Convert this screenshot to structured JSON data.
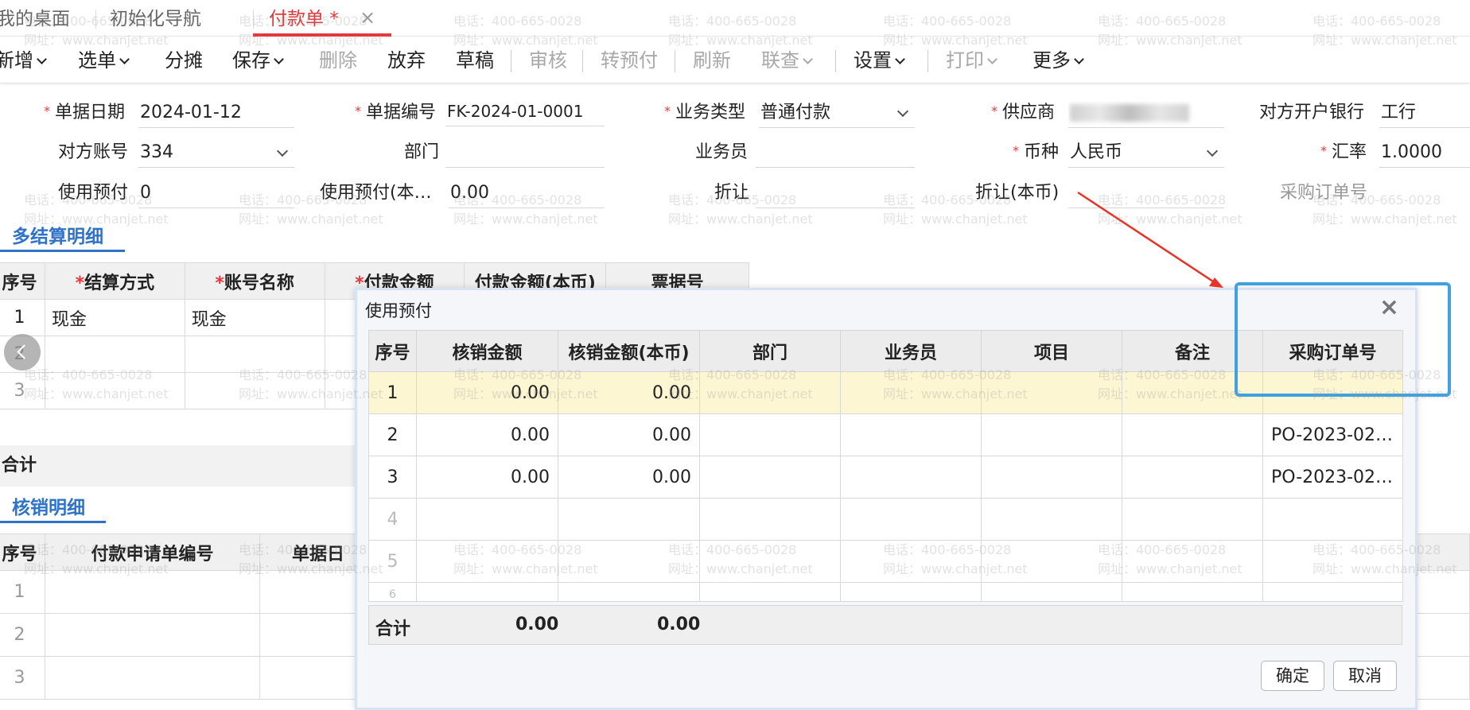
{
  "tabs": [
    {
      "label": "我的桌面"
    },
    {
      "label": "初始化导航"
    },
    {
      "label": "付款单 *"
    }
  ],
  "tab_close": "×",
  "toolbar": {
    "new": "新增",
    "select": "选单",
    "split": "分摊",
    "save": "保存",
    "delete": "删除",
    "discard": "放弃",
    "draft": "草稿",
    "audit": "审核",
    "to_prepay": "转预付",
    "refresh": "刷新",
    "linked": "联查",
    "settings": "设置",
    "print": "打印",
    "more": "更多"
  },
  "form": {
    "doc_date_label": "单据日期",
    "doc_date": "2024-01-12",
    "doc_no_label": "单据编号",
    "doc_no": "FK-2024-01-0001",
    "biz_type_label": "业务类型",
    "biz_type": "普通付款",
    "supplier_label": "供应商",
    "bank_label": "对方开户银行",
    "bank": "工行",
    "account_label": "对方账号",
    "account": "334",
    "dept_label": "部门",
    "dept": "",
    "clerk_label": "业务员",
    "clerk": "",
    "currency_label": "币种",
    "currency": "人民币",
    "rate_label": "汇率",
    "rate": "1.0000",
    "use_prepay_label": "使用预付",
    "use_prepay": "0",
    "use_prepay_local_label": "使用预付(本…",
    "use_prepay_local": "0.00",
    "discount_label": "折让",
    "discount": "",
    "discount_local_label": "折让(本币)",
    "discount_local": "",
    "po_label": "采购订单号"
  },
  "settle_section": {
    "title": "多结算明细",
    "headers": [
      "序号",
      "结算方式",
      "账号名称",
      "付款金额",
      "付款金额(本币)",
      "票据号"
    ],
    "rows": [
      {
        "no": "1",
        "method": "现金",
        "account": "现金"
      },
      {
        "no": "2",
        "method": "",
        "account": ""
      },
      {
        "no": "3",
        "method": "",
        "account": ""
      }
    ],
    "total_label": "合计"
  },
  "writeoff_section": {
    "title": "核销明细",
    "headers": [
      "序号",
      "付款申请单编号",
      "单据日"
    ],
    "rows": [
      "1",
      "2",
      "3"
    ]
  },
  "dialog": {
    "title": "使用预付",
    "close": "×",
    "headers": [
      "序号",
      "核销金额",
      "核销金额(本币)",
      "部门",
      "业务员",
      "项目",
      "备注",
      "采购订单号"
    ],
    "rows": [
      {
        "no": "1",
        "amt": "0.00",
        "amt_local": "0.00",
        "po": ""
      },
      {
        "no": "2",
        "amt": "0.00",
        "amt_local": "0.00",
        "po": "PO-2023-02…"
      },
      {
        "no": "3",
        "amt": "0.00",
        "amt_local": "0.00",
        "po": "PO-2023-02…"
      },
      {
        "no": "4",
        "amt": "",
        "amt_local": "",
        "po": ""
      },
      {
        "no": "5",
        "amt": "",
        "amt_local": "",
        "po": ""
      },
      {
        "no": "6",
        "amt": "",
        "amt_local": "",
        "po": ""
      }
    ],
    "total_label": "合计",
    "total_amt": "0.00",
    "total_amt_local": "0.00",
    "ok": "确定",
    "cancel": "取消"
  },
  "watermark": {
    "phone": "电话：400-665-0028",
    "site": "网址：www.chanjet.net"
  },
  "colors": {
    "accent_red": "#e4393c",
    "section_blue": "#2f73c9",
    "highlight_box": "#3fa1e0",
    "arrow": "#e8332a"
  }
}
